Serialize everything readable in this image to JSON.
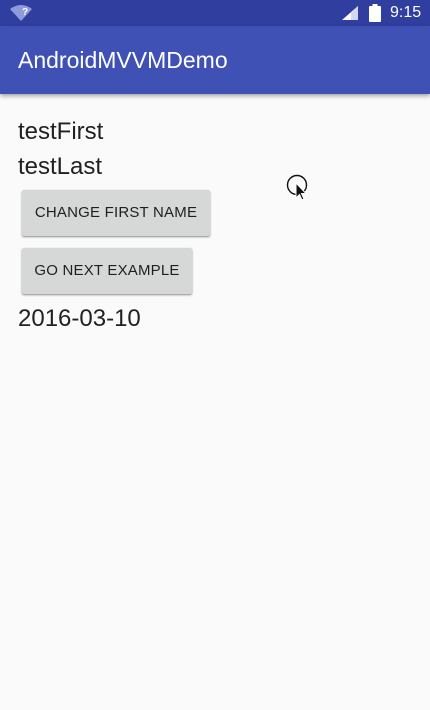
{
  "status_bar": {
    "time": "9:15",
    "icons": [
      "wifi-unknown-icon",
      "cell-signal-icon",
      "battery-icon"
    ],
    "wifi_label": "?"
  },
  "app_bar": {
    "title": "AndroidMVVMDemo",
    "color": "#3f51b5",
    "status_color": "#303f9f"
  },
  "content": {
    "first_name": "testFirst",
    "last_name": "testLast",
    "change_first_name_label": "CHANGE FIRST NAME",
    "go_next_example_label": "GO NEXT EXAMPLE",
    "date": "2016-03-10"
  }
}
